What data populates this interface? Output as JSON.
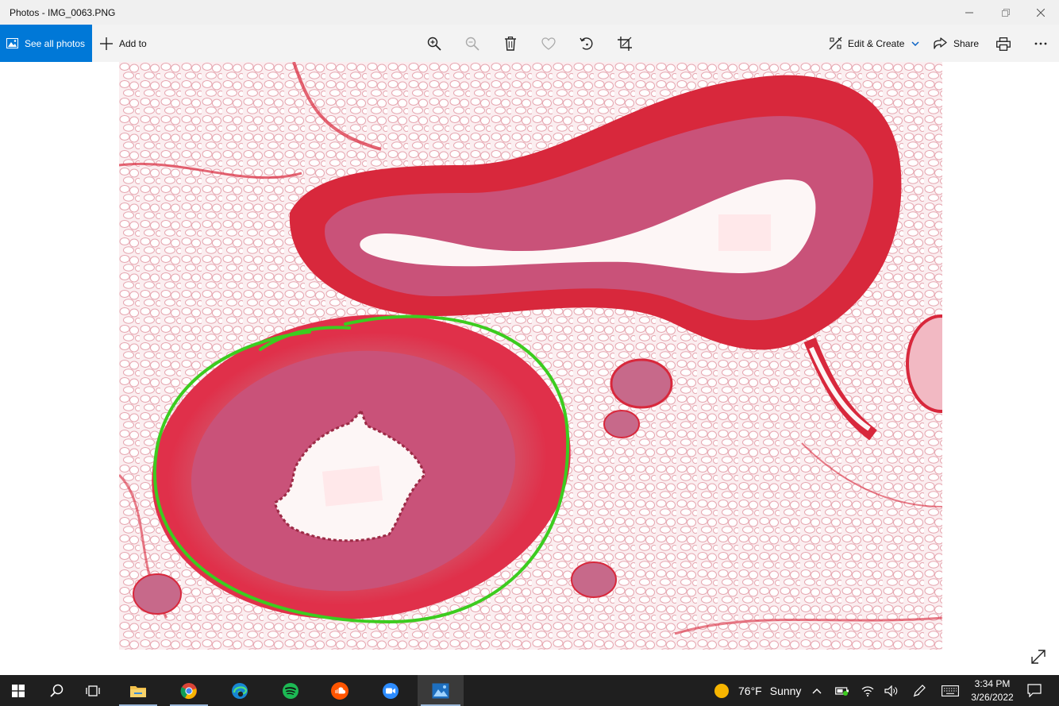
{
  "window": {
    "title": "Photos - IMG_0063.PNG"
  },
  "toolbar": {
    "see_all_label": "See all photos",
    "add_to_label": "Add to",
    "edit_create_label": "Edit & Create",
    "share_label": "Share",
    "icons": [
      "zoom-in-icon",
      "zoom-out-icon",
      "delete-icon",
      "favorite-icon",
      "rotate-icon",
      "crop-icon",
      "print-icon",
      "more-icon"
    ]
  },
  "taskbar": {
    "weather_temp": "76°F",
    "weather_condition": "Sunny",
    "time": "3:34 PM",
    "date": "3/26/2022"
  },
  "colors": {
    "accent": "#0078d7",
    "annotation": "#3ccc1f",
    "tissue_pink": "#e04a5f",
    "stain_red": "#d8283c"
  }
}
